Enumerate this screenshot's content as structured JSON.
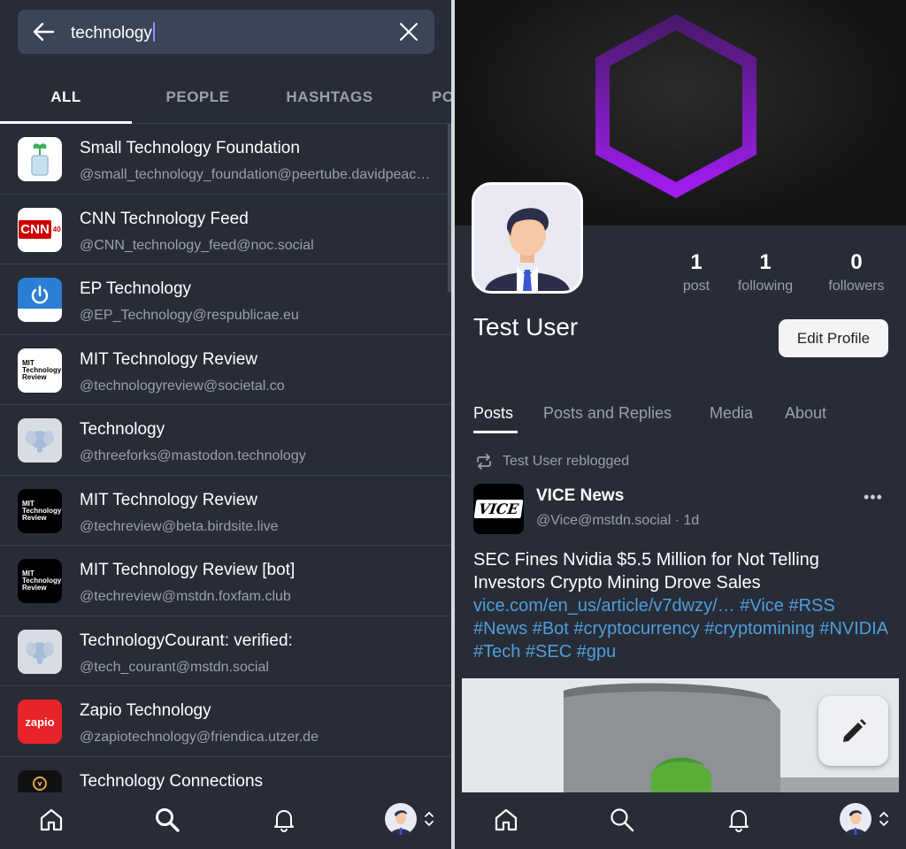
{
  "search": {
    "query": "technology"
  },
  "search_tabs": [
    {
      "label": "ALL",
      "active": true
    },
    {
      "label": "PEOPLE",
      "active": false
    },
    {
      "label": "HASHTAGS",
      "active": false
    },
    {
      "label": "PO",
      "active": false
    }
  ],
  "results": [
    {
      "name": "Small Technology Foundation",
      "handle": "@small_technology_foundation@peertube.davidpeach.me",
      "icon": "plant-jar-icon"
    },
    {
      "name": "CNN Technology Feed",
      "handle": "@CNN_technology_feed@noc.social",
      "icon": "cnn-logo"
    },
    {
      "name": "EP Technology",
      "handle": "@EP_Technology@respublicae.eu",
      "icon": "power-logo"
    },
    {
      "name": "MIT Technology Review",
      "handle": "@technologyreview@societal.co",
      "icon": "mit-tr-logo"
    },
    {
      "name": "Technology",
      "handle": "@threeforks@mastodon.technology",
      "icon": "mastodon-elephant-icon"
    },
    {
      "name": "MIT Technology Review",
      "handle": "@techreview@beta.birdsite.live",
      "icon": "mit-tr-logo-dark"
    },
    {
      "name": "MIT Technology Review [bot]",
      "handle": "@techreview@mstdn.foxfam.club",
      "icon": "mit-tr-logo-dark"
    },
    {
      "name": "TechnologyCourant: verified:",
      "handle": "@tech_courant@mstdn.social",
      "icon": "mastodon-elephant-icon"
    },
    {
      "name": "Zapio Technology",
      "handle": "@zapiotechnology@friendica.utzer.de",
      "icon": "zapio-logo"
    },
    {
      "name": "Technology Connections",
      "handle": "",
      "icon": "lightbulb-logo"
    }
  ],
  "logos": {
    "cnn": "CNN",
    "cnn_badge": "40",
    "mit_tr": "MIT Technology Review",
    "zapio": "zapio",
    "vice": "VICE"
  },
  "profile": {
    "display_name": "Test User",
    "stats": [
      {
        "num": "1",
        "label": "post"
      },
      {
        "num": "1",
        "label": "following"
      },
      {
        "num": "0",
        "label": "followers"
      }
    ],
    "edit_label": "Edit Profile",
    "tabs": [
      {
        "label": "Posts",
        "active": true
      },
      {
        "label": "Posts and Replies",
        "active": false
      },
      {
        "label": "Media",
        "active": false
      },
      {
        "label": "About",
        "active": false
      }
    ]
  },
  "post": {
    "reblog_text": "Test User reblogged",
    "author": "VICE News",
    "handle": "@Vice@mstdn.social · 1d",
    "more": "•••",
    "text": "SEC Fines Nvidia $5.5 Million for Not Telling Investors Crypto Mining Drove Sales ",
    "link": "vice.com/en_us/article/v7dwzy/…",
    "hashtags": "#Vice #RSS #News #Bot #cryptocurrency #cryptomining #NVIDIA #Tech #SEC #gpu"
  },
  "colors": {
    "background": "#282c37",
    "search_field": "#3c4557",
    "link": "#4e9fdc",
    "hexagon": "#9b1fd6",
    "muted_text": "#9aa0ad"
  }
}
